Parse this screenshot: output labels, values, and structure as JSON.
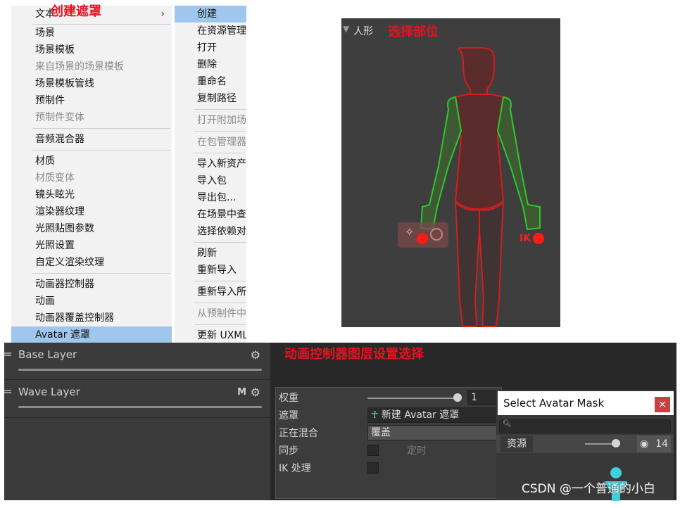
{
  "annotations": {
    "create_mask": "创建遮罩",
    "select_part": "选择部位",
    "layer_settings": "动画控制器图层设置选择",
    "ik": "IK"
  },
  "menu_left": {
    "items": [
      {
        "label": "文本",
        "disabled": false,
        "submenu": true
      },
      {
        "label": "场景",
        "disabled": false
      },
      {
        "label": "场景模板",
        "disabled": false
      },
      {
        "label": "来自场景的场景模板",
        "disabled": true
      },
      {
        "label": "场景模板管线",
        "disabled": false
      },
      {
        "label": "预制件",
        "disabled": false
      },
      {
        "label": "预制件变体",
        "disabled": true
      },
      {
        "label": "音频混合器",
        "disabled": false
      },
      {
        "label": "材质",
        "disabled": false
      },
      {
        "label": "材质变体",
        "disabled": true
      },
      {
        "label": "镜头眩光",
        "disabled": false
      },
      {
        "label": "渲染器纹理",
        "disabled": false
      },
      {
        "label": "光照贴图参数",
        "disabled": false
      },
      {
        "label": "光照设置",
        "disabled": false
      },
      {
        "label": "自定义渲染纹理",
        "disabled": false
      },
      {
        "label": "动画器控制器",
        "disabled": false
      },
      {
        "label": "动画",
        "disabled": false
      },
      {
        "label": "动画器覆盖控制器",
        "disabled": false
      },
      {
        "label": "Avatar 遮罩",
        "disabled": false,
        "selected": true
      }
    ]
  },
  "menu_right": {
    "items": [
      {
        "label": "创建",
        "disabled": false,
        "selected": true
      },
      {
        "label": "在资源管理器中显示",
        "disabled": false
      },
      {
        "label": "打开",
        "disabled": false
      },
      {
        "label": "删除",
        "disabled": false
      },
      {
        "label": "重命名",
        "disabled": false
      },
      {
        "label": "复制路径",
        "disabled": false
      },
      {
        "label": "打开附加场景",
        "disabled": true
      },
      {
        "label": "在包管理器中查看",
        "disabled": true
      },
      {
        "label": "导入新资产...",
        "disabled": false
      },
      {
        "label": "导入包",
        "disabled": false
      },
      {
        "label": "导出包...",
        "disabled": false
      },
      {
        "label": "在场景中查找引用",
        "disabled": false
      },
      {
        "label": "选择依赖对象",
        "disabled": false
      },
      {
        "label": "刷新",
        "disabled": false
      },
      {
        "label": "重新导入",
        "disabled": false
      },
      {
        "label": "重新导入所有",
        "disabled": false
      },
      {
        "label": "从预制件中提取",
        "disabled": true
      },
      {
        "label": "更新 UXML Schema",
        "disabled": false
      }
    ]
  },
  "humanoid": {
    "header": "人形",
    "colors": {
      "body": "#d01f1f",
      "arms": "#2fc62f",
      "bg": "#3e3e3e"
    }
  },
  "animator": {
    "layers": [
      {
        "name": "Base Layer",
        "flag": ""
      },
      {
        "name": "Wave Layer",
        "flag": "M"
      }
    ],
    "settings": {
      "weight_label": "权重",
      "weight_value": "1",
      "weight_fraction": 1.0,
      "mask_label": "遮罩",
      "mask_value": "新建 Avatar 遮罩",
      "blending_label": "正在混合",
      "blending_value": "覆盖",
      "sync_label": "同步",
      "timing_label": "定时",
      "ik_label": "IK 处理"
    }
  },
  "select_mask": {
    "title": "Select Avatar Mask",
    "tab": "资源",
    "count": "14"
  },
  "watermark": "CSDN @一个普通的小白"
}
